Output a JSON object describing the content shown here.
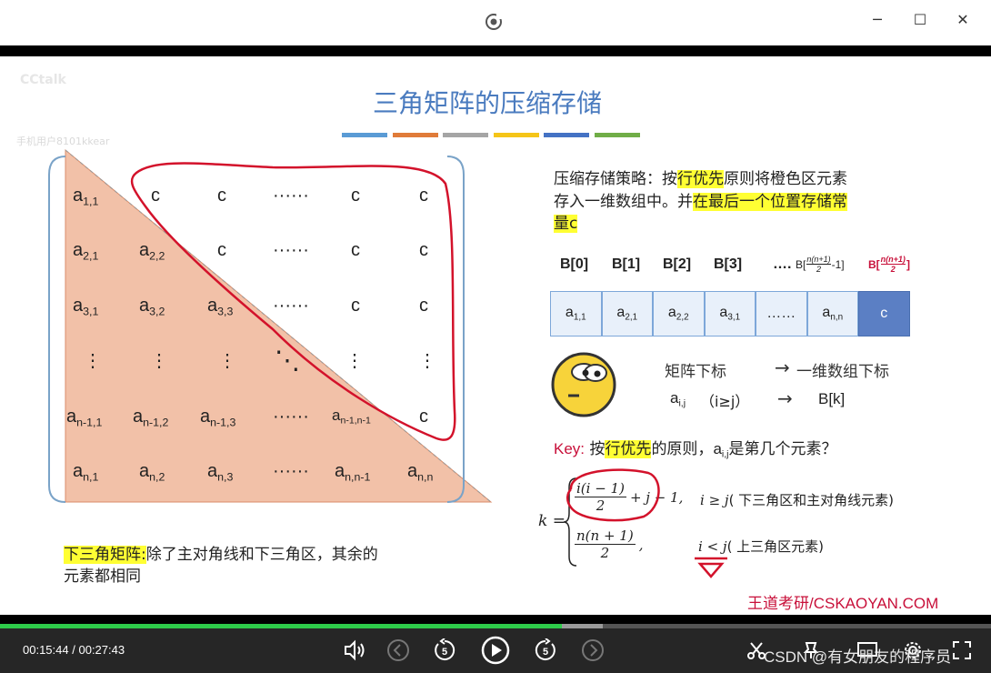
{
  "window": {
    "minimize_label": "─",
    "maximize_label": "☐",
    "close_label": "✕"
  },
  "slide": {
    "watermark_top": "CCtalk",
    "watermark_user": "手机用户8101kkear",
    "title": "三角矩阵的压缩存储",
    "title_colors": [
      "#5a9bd5",
      "#e07b39",
      "#a5a5a5",
      "#f5c518",
      "#4472c4",
      "#70ad47"
    ],
    "matrix": {
      "rows": [
        [
          {
            "b": "a",
            "s": "1,1"
          },
          {
            "b": "c",
            "s": ""
          },
          {
            "b": "c",
            "s": ""
          },
          {
            "b": "······",
            "s": ""
          },
          {
            "b": "c",
            "s": ""
          },
          {
            "b": "c",
            "s": ""
          }
        ],
        [
          {
            "b": "a",
            "s": "2,1"
          },
          {
            "b": "a",
            "s": "2,2"
          },
          {
            "b": "c",
            "s": ""
          },
          {
            "b": "······",
            "s": ""
          },
          {
            "b": "c",
            "s": ""
          },
          {
            "b": "c",
            "s": ""
          }
        ],
        [
          {
            "b": "a",
            "s": "3,1"
          },
          {
            "b": "a",
            "s": "3,2"
          },
          {
            "b": "a",
            "s": "3,3"
          },
          {
            "b": "······",
            "s": ""
          },
          {
            "b": "c",
            "s": ""
          },
          {
            "b": "c",
            "s": ""
          }
        ],
        [
          {
            "b": "⋮",
            "s": ""
          },
          {
            "b": "⋮",
            "s": ""
          },
          {
            "b": "⋮",
            "s": ""
          },
          {
            "b": "⋱",
            "s": ""
          },
          {
            "b": "⋮",
            "s": ""
          },
          {
            "b": "⋮",
            "s": ""
          }
        ],
        [
          {
            "b": "a",
            "s": "n-1,1"
          },
          {
            "b": "a",
            "s": "n-1,2"
          },
          {
            "b": "a",
            "s": "n-1,3"
          },
          {
            "b": "······",
            "s": ""
          },
          {
            "b": "a",
            "s": "n-1,n-1"
          },
          {
            "b": "c",
            "s": ""
          }
        ],
        [
          {
            "b": "a",
            "s": "n,1"
          },
          {
            "b": "a",
            "s": "n,2"
          },
          {
            "b": "a",
            "s": "n,3"
          },
          {
            "b": "······",
            "s": ""
          },
          {
            "b": "a",
            "s": "n,n-1"
          },
          {
            "b": "a",
            "s": "n,n"
          }
        ]
      ]
    },
    "strategy": {
      "p1": "压缩存储策略：按",
      "h1": "行优先",
      "p2": "原则将橙色区元素",
      "line2a": "存入一维数组中。并",
      "h2": "在最后一个位置存储常",
      "h3": "量c"
    },
    "array_headers": [
      "B[0]",
      "B[1]",
      "B[2]",
      "B[3]",
      "…."
    ],
    "array_header_tail": {
      "prefix": "B[",
      "num": "n(n+1)",
      "den": "2",
      "suffix": "-1]"
    },
    "array_header_last": {
      "prefix": "B[",
      "num": "n(n+1)",
      "den": "2",
      "suffix": "]"
    },
    "array_cells": [
      {
        "b": "a",
        "s": "1,1"
      },
      {
        "b": "a",
        "s": "2,1"
      },
      {
        "b": "a",
        "s": "2,2"
      },
      {
        "b": "a",
        "s": "3,1"
      },
      {
        "b": "……",
        "s": ""
      },
      {
        "b": "a",
        "s": "n,n"
      }
    ],
    "array_last_cell": "c",
    "mapping": {
      "head_left": "矩阵下标",
      "arrow": "→",
      "head_right": "一维数组下标",
      "elem_base": "a",
      "elem_sub": "i,j",
      "cond": "（i≥j）",
      "target": "B[k]"
    },
    "key": {
      "label": "Key:",
      "p1": "按",
      "hl": "行优先",
      "p2": "的原则，",
      "elem_base": "a",
      "elem_sub": "i,j",
      "p3": "是第几个元素？"
    },
    "formula": {
      "lhs": "k =",
      "case1_num": "i(i − 1)",
      "case1_den": "2",
      "case1_tail": "+ j − 1,",
      "case1_cond": "i ≥ j",
      "case1_desc": "( 下三角区和主对角线元素)",
      "case2_num": "n(n + 1)",
      "case2_den": "2",
      "case2_tail": ",",
      "case2_cond": "i < j",
      "case2_desc": "( 上三角区元素)"
    },
    "lower_note": {
      "hl": "下三角矩阵:",
      "rest": "除了主对角线和下三角区，其余的",
      "line2": "元素都相同"
    },
    "footer": "王道考研/CSKAOYAN.COM"
  },
  "player": {
    "current_time": "00:15:44",
    "separator": "/",
    "total_time": "00:27:43",
    "progress": 0.567,
    "buffered": 0.608,
    "skip_back_seconds": "5",
    "skip_forward_seconds": "5",
    "watermark": "CSDN @有女朋友的程序员"
  }
}
